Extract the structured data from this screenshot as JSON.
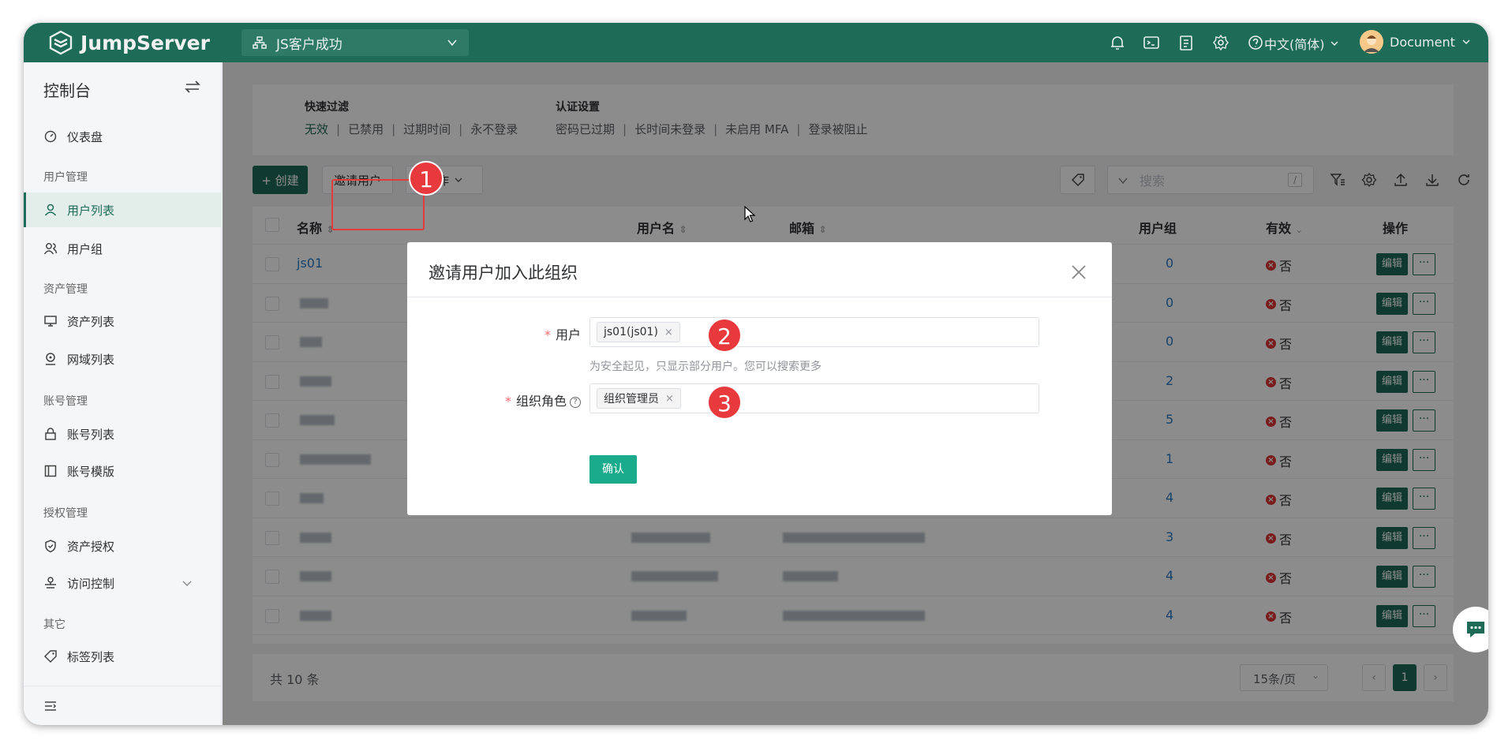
{
  "topbar": {
    "logo": "JumpServer",
    "org": "JS客户成功",
    "language": "中文(简体)",
    "username": "Document"
  },
  "sidebar": {
    "title": "控制台",
    "items": [
      {
        "label": "仪表盘",
        "icon": "dashboard-icon"
      },
      {
        "group": "用户管理"
      },
      {
        "label": "用户列表",
        "icon": "user-icon",
        "active": true
      },
      {
        "label": "用户组",
        "icon": "users-icon"
      },
      {
        "group": "资产管理"
      },
      {
        "label": "资产列表",
        "icon": "monitor-icon"
      },
      {
        "label": "网域列表",
        "icon": "location-icon"
      },
      {
        "group": "账号管理"
      },
      {
        "label": "账号列表",
        "icon": "lock-icon"
      },
      {
        "label": "账号模版",
        "icon": "template-icon"
      },
      {
        "group": "授权管理"
      },
      {
        "label": "资产授权",
        "icon": "shield-icon"
      },
      {
        "label": "访问控制",
        "icon": "access-icon",
        "expandable": true
      },
      {
        "group": "其它"
      },
      {
        "label": "标签列表",
        "icon": "tag-icon"
      }
    ]
  },
  "filter": {
    "quick_label": "快速过滤",
    "quick_links": [
      "无效",
      "已禁用",
      "过期时间",
      "永不登录"
    ],
    "auth_label": "认证设置",
    "auth_links": [
      "密码已过期",
      "长时间未登录",
      "未启用 MFA",
      "登录被阻止"
    ]
  },
  "toolbar": {
    "create": "+ 创建",
    "invite": "邀请用户",
    "more": "操作",
    "search_placeholder": "搜索",
    "search_shortcut": "/"
  },
  "table": {
    "headers": {
      "name": "名称",
      "username": "用户名",
      "email": "邮箱",
      "group": "用户组",
      "valid": "有效",
      "actions": "操作"
    },
    "rows": [
      {
        "name": "js01",
        "group": "0",
        "valid": "否"
      },
      {
        "name": "",
        "group": "0",
        "valid": "否"
      },
      {
        "name": "",
        "group": "0",
        "valid": "否"
      },
      {
        "name": "",
        "group": "2",
        "valid": "否"
      },
      {
        "name": "",
        "group": "5",
        "valid": "否"
      },
      {
        "name": "",
        "group": "1",
        "valid": "否"
      },
      {
        "name": "",
        "group": "4",
        "valid": "否"
      },
      {
        "name": "",
        "group": "3",
        "valid": "否"
      },
      {
        "name": "",
        "group": "4",
        "valid": "否"
      },
      {
        "name": "",
        "group": "4",
        "valid": "否"
      }
    ],
    "edit_label": "编辑",
    "more_label": "···",
    "total": "共 10 条",
    "page_size": "15条/页",
    "current_page": "1"
  },
  "dialog": {
    "title": "邀请用户加入此组织",
    "user_label": "用户",
    "user_value": "js01(js01)",
    "user_hint": "为安全起见，只显示部分用户。您可以搜索更多",
    "role_label": "组织角色",
    "role_value": "组织管理员",
    "confirm": "确认"
  },
  "callouts": [
    "1",
    "2",
    "3"
  ],
  "colors": {
    "brand": "#1e6b57",
    "highlight": "#e43b3b",
    "link": "#2b79c2"
  }
}
